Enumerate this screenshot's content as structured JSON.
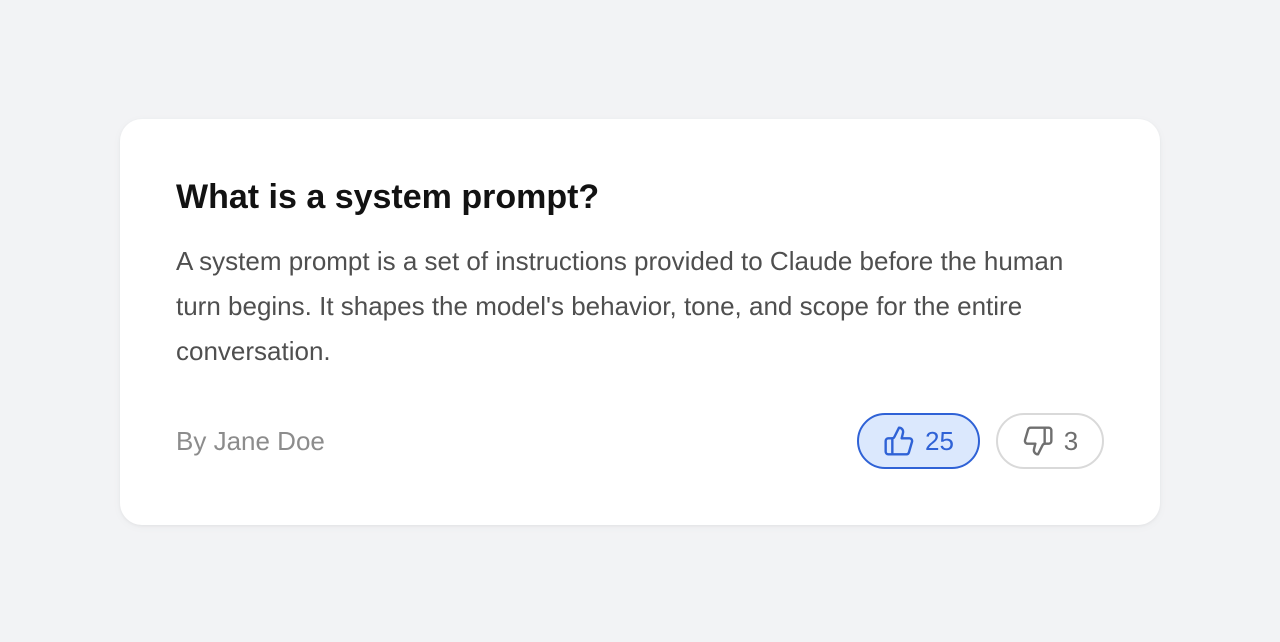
{
  "post": {
    "title": "What is a system prompt?",
    "body": "A system prompt is a set of instructions provided to Claude before the human turn begins. It shapes the model's behavior, tone, and scope for the entire conversation.",
    "author": "By Jane Doe"
  },
  "votes": {
    "up": {
      "count": "25",
      "icon": "thumbs-up-icon",
      "selected": true
    },
    "down": {
      "count": "3",
      "icon": "thumbs-down-icon",
      "selected": false
    }
  },
  "colors": {
    "page_background": "#f2f3f5",
    "card_background": "#ffffff",
    "title": "#121212",
    "body_text": "#4f4f4f",
    "muted_text": "#8c8c8c",
    "accent": "#2f62d6",
    "accent_fill": "#dbe8fd",
    "neutral_border": "#d9d9d9",
    "neutral_text": "#6f6f6f"
  }
}
